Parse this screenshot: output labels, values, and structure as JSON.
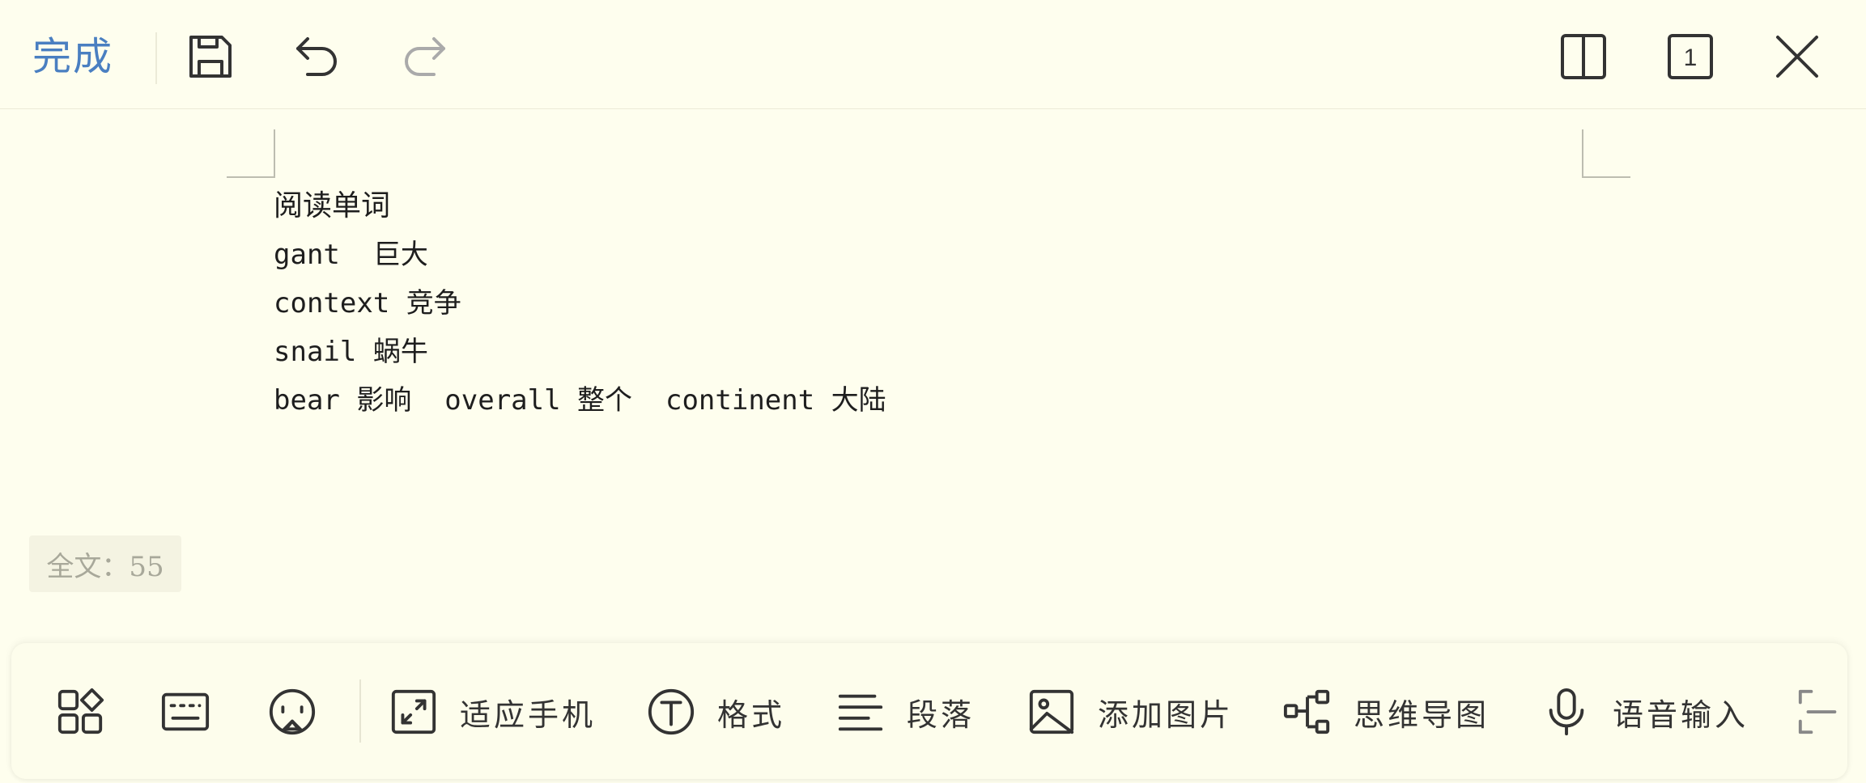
{
  "toolbar": {
    "done_label": "完成",
    "icons": [
      "save-icon",
      "undo-icon",
      "redo-icon",
      "split-view-icon",
      "page-number-icon",
      "close-icon"
    ],
    "page_number": "1"
  },
  "document": {
    "lines": [
      "阅读单词",
      "gant  巨大",
      "context 竞争",
      "snail 蜗牛",
      "bear 影响  overall 整个  continent 大陆"
    ]
  },
  "status": {
    "word_count_label": "全文：55"
  },
  "bottom_toolbar": {
    "icons": [
      "apps-icon",
      "keyboard-icon",
      "emoji-icon"
    ],
    "items": [
      {
        "icon": "fit-screen-icon",
        "label": "适应手机"
      },
      {
        "icon": "format-icon",
        "label": "格式"
      },
      {
        "icon": "paragraph-icon",
        "label": "段落"
      },
      {
        "icon": "image-icon",
        "label": "添加图片"
      },
      {
        "icon": "mindmap-icon",
        "label": "思维导图"
      },
      {
        "icon": "microphone-icon",
        "label": "语音输入"
      }
    ]
  },
  "colors": {
    "background": "#fefeee",
    "accent": "#4a7fc1",
    "icon": "#333333"
  }
}
